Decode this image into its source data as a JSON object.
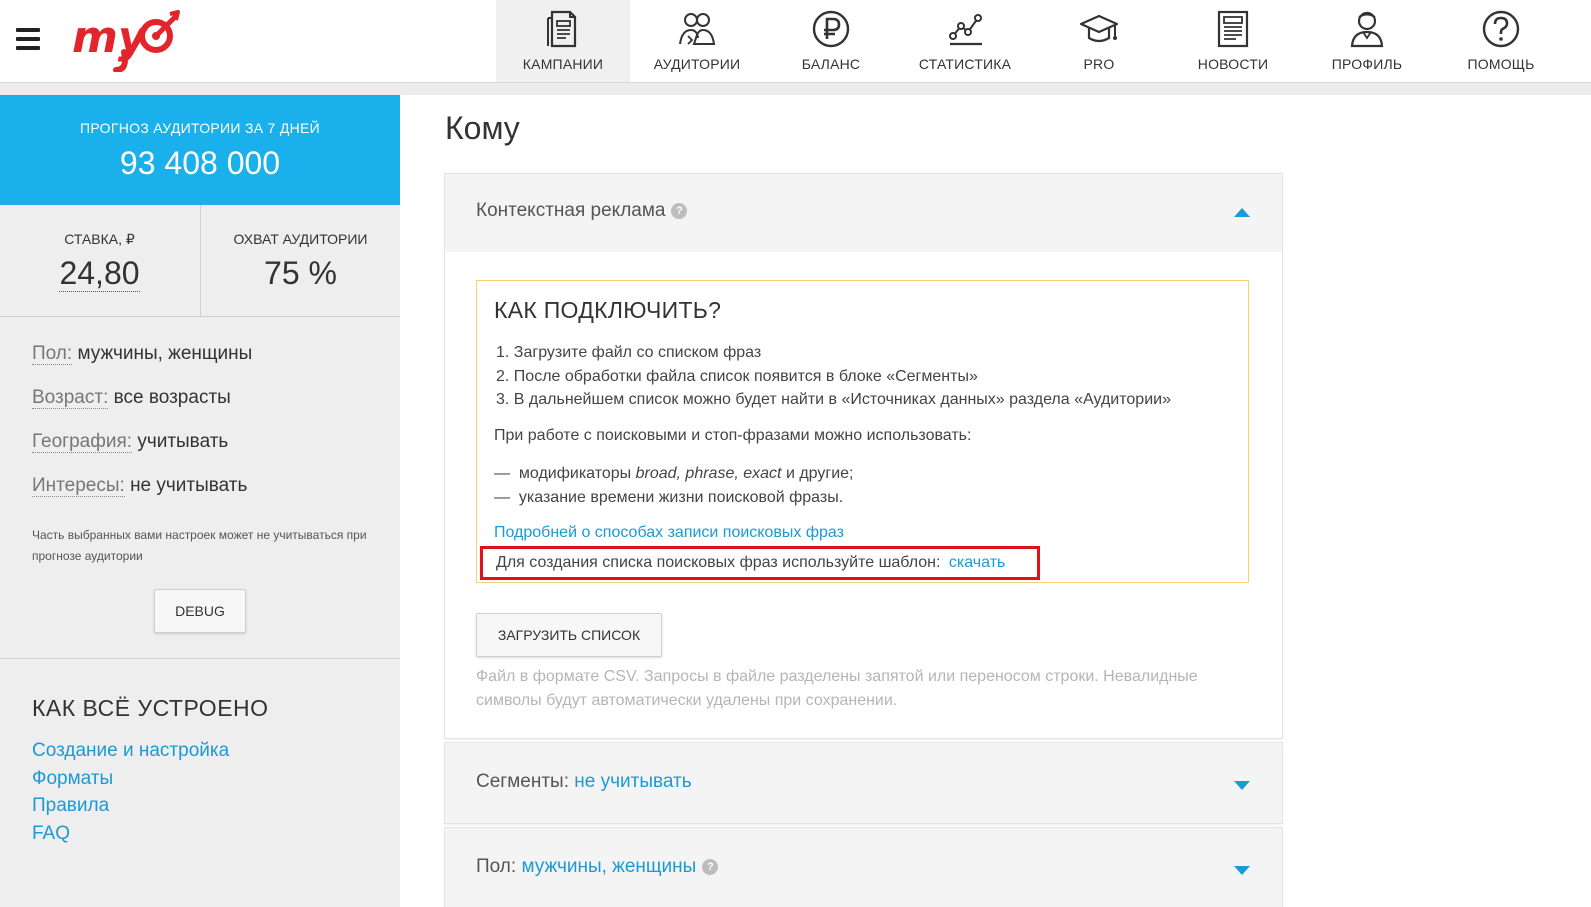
{
  "header": {
    "logo_text": "my",
    "nav": [
      {
        "label": "КАМПАНИИ",
        "icon": "campaigns-icon",
        "active": true
      },
      {
        "label": "АУДИТОРИИ",
        "icon": "audiences-icon",
        "active": false
      },
      {
        "label": "БАЛАНС",
        "icon": "ruble-icon",
        "active": false
      },
      {
        "label": "СТАТИСТИКА",
        "icon": "statistics-icon",
        "active": false
      },
      {
        "label": "PRO",
        "icon": "graduation-cap-icon",
        "active": false
      },
      {
        "label": "НОВОСТИ",
        "icon": "news-icon",
        "active": false
      },
      {
        "label": "ПРОФИЛЬ",
        "icon": "profile-icon",
        "active": false
      },
      {
        "label": "ПОМОЩЬ",
        "icon": "help-icon",
        "active": false
      }
    ]
  },
  "sidebar": {
    "forecast_label": "ПРОГНОЗ АУДИТОРИИ ЗА 7 ДНЕЙ",
    "forecast_value": "93 408 000",
    "bid_label": "СТАВКА, ₽",
    "bid_value": "24,80",
    "reach_label": "ОХВАТ АУДИТОРИИ",
    "reach_value": "75 %",
    "params": [
      {
        "key": "Пол:",
        "value": "мужчины, женщины"
      },
      {
        "key": "Возраст:",
        "value": "все возрасты"
      },
      {
        "key": "География:",
        "value": "учитывать"
      },
      {
        "key": "Интересы:",
        "value": "не учитывать"
      }
    ],
    "note": "Часть выбранных вами настроек может не учитываться при прогнозе аудитории",
    "debug_label": "DEBUG",
    "howto_title": "КАК ВСЁ УСТРОЕНО",
    "howto_links": [
      "Создание и настройка",
      "Форматы",
      "Правила",
      "FAQ"
    ]
  },
  "main": {
    "title": "Кому",
    "context_card": {
      "title": "Контекстная реклама",
      "help": "?",
      "info_title": "КАК ПОДКЛЮЧИТЬ?",
      "steps": [
        "1. Загрузите файл со списком фраз",
        "2. После обработки файла список появится в блоке «Сегменты»",
        "3. В дальнейшем список можно будет найти в «Источниках данных» раздела «Аудитории»"
      ],
      "modifiers_intro": "При работе с поисковыми и стоп-фразами можно использовать:",
      "bullet_dash": "—",
      "bullet1_prefix": "модификаторы",
      "bullet1_italic": "broad, phrase, exact",
      "bullet1_suffix": "и другие;",
      "bullet2": "указание времени жизни поисковой фразы.",
      "more_link": "Подробней о способах записи поисковых фраз",
      "template_text": "Для создания списка поисковых фраз используйте шаблон:",
      "template_link": "скачать",
      "upload_label": "ЗАГРУЗИТЬ СПИСОК",
      "upload_hint": "Файл в формате CSV. Запросы в файле разделены запятой или переносом строки. Невалидные символы будут автоматически удалены при сохранении."
    },
    "segments_card": {
      "label": "Сегменты:",
      "value": "не учитывать"
    },
    "gender_card": {
      "label": "Пол:",
      "value": "мужчины, женщины",
      "help": "?"
    }
  },
  "colors": {
    "brand_red": "#e3242b",
    "accent_blue": "#1ab0ec",
    "link_blue": "#1a9ad6",
    "highlight_red": "#e0111a"
  }
}
